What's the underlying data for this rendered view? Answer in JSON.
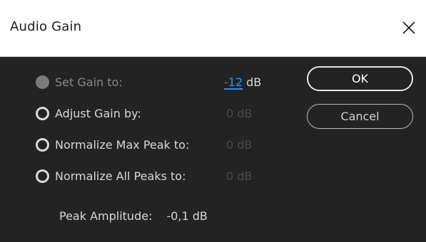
{
  "dialog": {
    "title": "Audio Gain",
    "close_icon": "close-icon"
  },
  "options": [
    {
      "label": "Set Gain to:",
      "value": "-12",
      "unit": "dB",
      "selected": true
    },
    {
      "label": "Adjust Gain by:",
      "value": "0",
      "unit": "dB",
      "selected": false
    },
    {
      "label": "Normalize Max Peak to:",
      "value": "0",
      "unit": "dB",
      "selected": false
    },
    {
      "label": "Normalize All Peaks to:",
      "value": "0",
      "unit": "dB",
      "selected": false
    }
  ],
  "buttons": {
    "ok": "OK",
    "cancel": "Cancel"
  },
  "peak": {
    "label": "Peak Amplitude:",
    "value": "-0,1 dB"
  },
  "colors": {
    "background": "#232323",
    "titlebar": "#ffffff",
    "accent": "#3a8ee6",
    "text": "#d8d8d8",
    "disabled_text": "#4a4a4a"
  }
}
